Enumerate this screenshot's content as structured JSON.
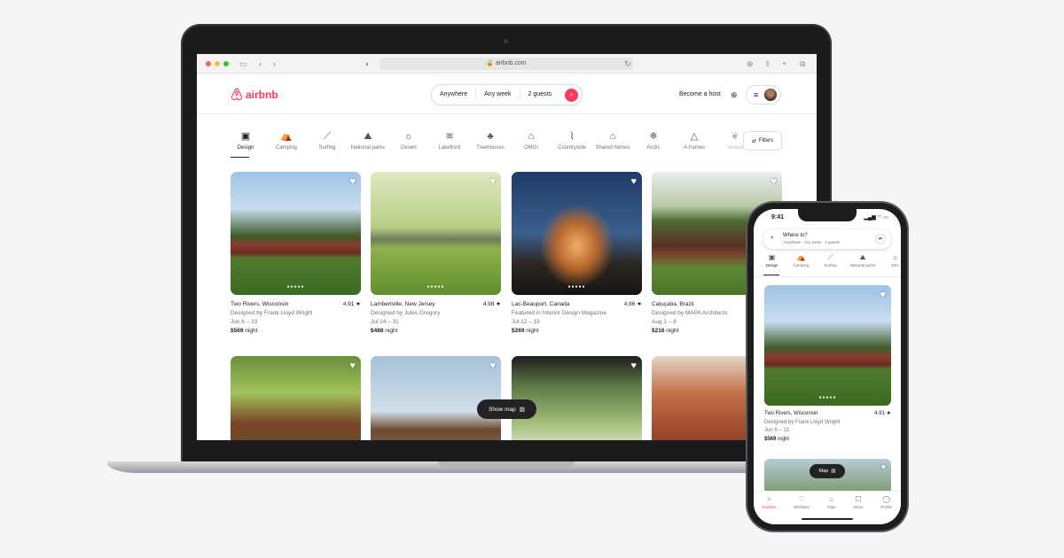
{
  "colors": {
    "brand": "#ff385c",
    "dot_red": "#fe5f57",
    "dot_yellow": "#febc2e",
    "dot_green": "#28c840"
  },
  "browser": {
    "url": "airbnb.com"
  },
  "header": {
    "logo_text": "airbnb",
    "search": {
      "where": "Anywhere",
      "when": "Any week",
      "guests": "2 guests"
    },
    "become_host": "Become a host"
  },
  "categories": [
    {
      "label": "Design",
      "icon": "design-icon",
      "glyph": "▣"
    },
    {
      "label": "Camping",
      "icon": "camping-icon",
      "glyph": "⛺"
    },
    {
      "label": "Surfing",
      "icon": "surfing-icon",
      "glyph": "⟋"
    },
    {
      "label": "National parks",
      "icon": "national-parks-icon",
      "glyph": "⛰"
    },
    {
      "label": "Desert",
      "icon": "desert-icon",
      "glyph": "☼"
    },
    {
      "label": "Lakefront",
      "icon": "lakefront-icon",
      "glyph": "≋"
    },
    {
      "label": "Treehouses",
      "icon": "treehouses-icon",
      "glyph": "♣"
    },
    {
      "label": "OMG!",
      "icon": "omg-icon",
      "glyph": "⌂"
    },
    {
      "label": "Countryside",
      "icon": "countryside-icon",
      "glyph": "⌇"
    },
    {
      "label": "Shared homes",
      "icon": "shared-homes-icon",
      "glyph": "⌂"
    },
    {
      "label": "Arctic",
      "icon": "arctic-icon",
      "glyph": "❄"
    },
    {
      "label": "A-frames",
      "icon": "a-frames-icon",
      "glyph": "△"
    },
    {
      "label": "Vineya",
      "icon": "vineyards-icon",
      "glyph": "❦"
    }
  ],
  "filters_label": "Filters",
  "listings": [
    {
      "title": "Two Rivers, Wisconsin",
      "rating": "4.91",
      "desc": "Designed by Frank Lloyd Wright",
      "dates": "Jun 6 – 13",
      "price": "$569",
      "unit": "night"
    },
    {
      "title": "Lambertville, New Jersey",
      "rating": "4.98",
      "desc": "Designed by Jules Gregory",
      "dates": "Jul 24 – 31",
      "price": "$488",
      "unit": "night"
    },
    {
      "title": "Lac-Beauport, Canada",
      "rating": "4.86",
      "desc": "Featured in Interior Design Magazine",
      "dates": "Jul 12 – 19",
      "price": "$269",
      "unit": "night"
    },
    {
      "title": "Catuçaba, Brazil",
      "rating": "",
      "desc": "Designed by MAPA Architects",
      "dates": "Aug 1 – 8",
      "price": "$216",
      "unit": "night"
    }
  ],
  "show_map_label": "Show map",
  "phone": {
    "time": "9:41",
    "search_title": "Where to?",
    "search_sub": "Anywhere · Any week · 2 guests",
    "categories": [
      {
        "label": "Design",
        "glyph": "▣"
      },
      {
        "label": "Camping",
        "glyph": "⛺"
      },
      {
        "label": "Surfing",
        "glyph": "⟋"
      },
      {
        "label": "National parks",
        "glyph": "⛰"
      },
      {
        "label": "Des",
        "glyph": "☼"
      }
    ],
    "listing": {
      "title": "Two Rivers, Wisconsin",
      "rating": "4.91",
      "desc": "Designed by Frank Lloyd Wright",
      "dates": "Jun 6 – 13",
      "price": "$569",
      "unit": "night"
    },
    "map_label": "Map",
    "tabs": [
      {
        "label": "Explore",
        "glyph": "⌕"
      },
      {
        "label": "Wishlists",
        "glyph": "♡"
      },
      {
        "label": "Trips",
        "glyph": "⌂"
      },
      {
        "label": "Inbox",
        "glyph": "☐"
      },
      {
        "label": "Profile",
        "glyph": "◯"
      }
    ]
  }
}
